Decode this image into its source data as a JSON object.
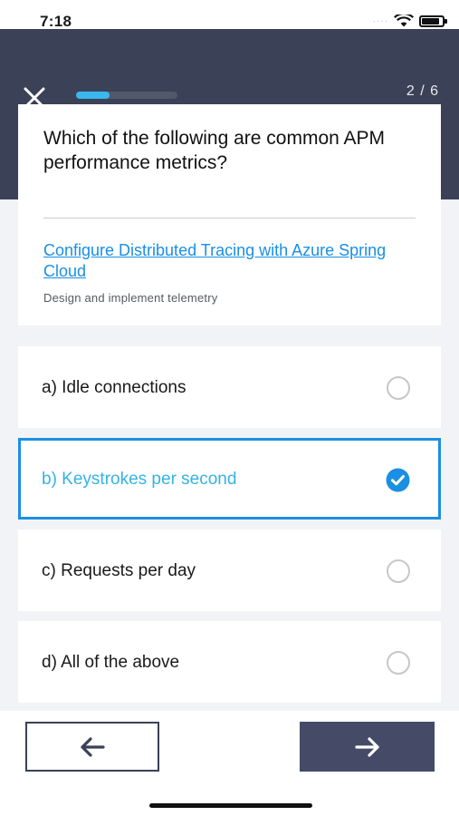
{
  "status_bar": {
    "time": "7:18"
  },
  "header": {
    "close_icon": "close-icon",
    "counter": "2 / 6",
    "progress": 0.33,
    "progress_color": "#3ab8ee",
    "background": "#3b4157"
  },
  "question": {
    "text": "Which of the following are common APM performance metrics?",
    "reference_link": "Configure Distributed Tracing with Azure Spring Cloud",
    "topic": "Design and implement telemetry"
  },
  "options": [
    {
      "label": "a) Idle connections",
      "selected": false
    },
    {
      "label": "b) Keystrokes per second",
      "selected": true
    },
    {
      "label": "c) Requests per day",
      "selected": false
    },
    {
      "label": "d) All of the above",
      "selected": false
    }
  ],
  "navigation": {
    "prev_icon": "arrow-left-icon",
    "next_icon": "arrow-right-icon"
  },
  "colors": {
    "accent": "#1a8fe3",
    "selected_text": "#34b3e6",
    "nav_dark": "#454b67"
  }
}
